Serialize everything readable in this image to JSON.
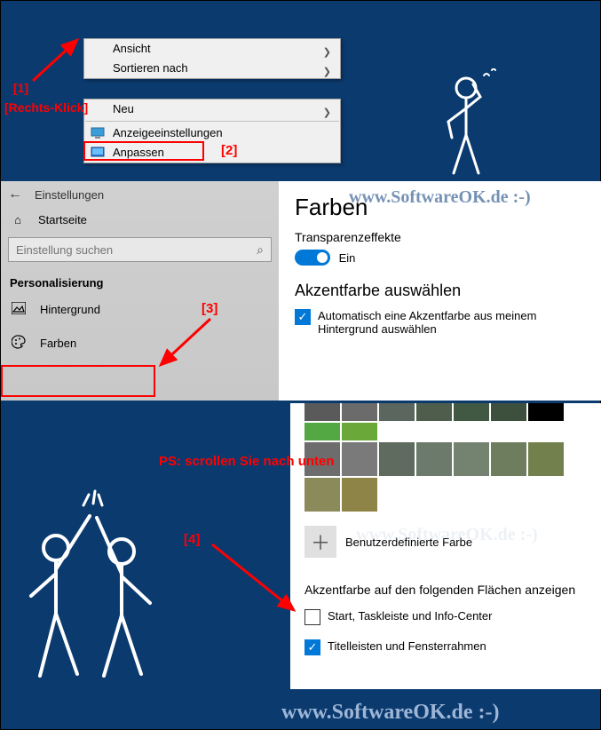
{
  "context_menu_top": {
    "view": "Ansicht",
    "sort": "Sortieren nach"
  },
  "context_menu_bottom": {
    "new": "Neu",
    "display_settings": "Anzeigeeinstellungen",
    "personalize": "Anpassen"
  },
  "annotations": {
    "a1": "[1]",
    "right_click": "[Rechts-Klick]",
    "a2": "[2]",
    "a3": "[3]",
    "a4": "[4]",
    "scroll_hint": "PS: scrollen Sie nach unten"
  },
  "settings": {
    "title": "Einstellungen",
    "home": "Startseite",
    "search_placeholder": "Einstellung suchen",
    "category": "Personalisierung",
    "nav_background": "Hintergrund",
    "nav_colors": "Farben"
  },
  "colors_panel": {
    "heading": "Farben",
    "transparency": "Transparenzeffekte",
    "toggle_on": "Ein",
    "accent_heading": "Akzentfarbe auswählen",
    "auto_accent": "Automatisch eine Akzentfarbe aus meinem Hintergrund auswählen"
  },
  "lower_panel": {
    "custom_color": "Benutzerdefinierte Farbe",
    "show_on_heading": "Akzentfarbe auf den folgenden Flächen anzeigen",
    "start_taskbar": "Start, Taskleiste und Info-Center",
    "titlebars": "Titelleisten und Fensterrahmen"
  },
  "watermark": "www.SoftwareOK.de :-)",
  "swatch_colors_row1": [
    "#5a5a5a",
    "#6b6b6b",
    "#5b665f",
    "#4f5e4c",
    "#415843",
    "#3d4f3d",
    "#000000",
    "#54a844",
    "#6aa83a"
  ],
  "swatch_colors_row2": [
    "#6d6d6d",
    "#7a7a7a",
    "#5e6b5e",
    "#6b7a6b",
    "#73836f",
    "#6f7d5f",
    "#72804e",
    "#8a8a5a",
    "#8f8447"
  ]
}
